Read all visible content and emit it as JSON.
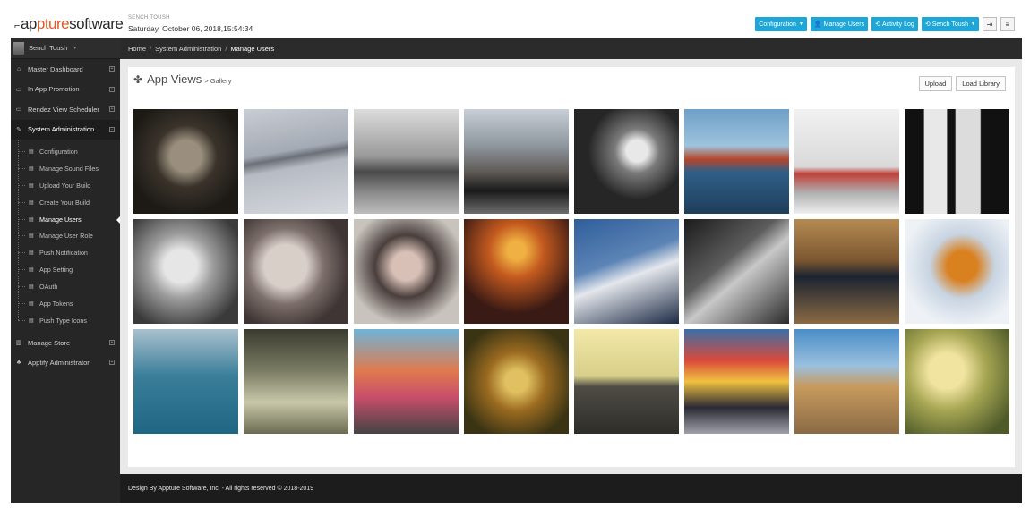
{
  "header": {
    "logo_prefix": "ap",
    "logo_accent": "pture",
    "logo_suffix": "software",
    "app_name": "SENCH TOUSH",
    "datetime": "Saturday, October 06, 2018,15:54:34",
    "buttons": [
      {
        "label": "Configuration",
        "icon": "",
        "caret": true
      },
      {
        "label": "Manage Users",
        "icon": "user-icon",
        "caret": false
      },
      {
        "label": "Activity Log",
        "icon": "history-icon",
        "caret": false
      },
      {
        "label": "Sench Toush",
        "icon": "history-icon",
        "caret": true
      }
    ],
    "accent_color": "#1fa6d9"
  },
  "sidebar": {
    "user": "Sench Toush",
    "menu": [
      {
        "label": "Master Dashboard",
        "icon": "home-icon"
      },
      {
        "label": "In App Promotion",
        "icon": "monitor-icon"
      },
      {
        "label": "Rendez View Scheduler",
        "icon": "monitor-icon"
      },
      {
        "label": "System Administration",
        "icon": "edit-icon",
        "active": true
      }
    ],
    "submenu": [
      "Configuration",
      "Manage Sound Files",
      "Upload Your Build",
      "Create Your Build",
      "Manage Users",
      "Manage User Role",
      "Push Notification",
      "App Setting",
      "OAuth",
      "App Tokens",
      "Push Type Icons"
    ],
    "active_submenu": "Manage Users",
    "menu_bottom": [
      {
        "label": "Manage Store",
        "icon": "store-icon"
      },
      {
        "label": "Apptify Administrator",
        "icon": "sitemap-icon"
      }
    ]
  },
  "breadcrumb": [
    "Home",
    "System Administration",
    "Manage Users"
  ],
  "content": {
    "title": "App Views",
    "subtitle": "> Gallery",
    "upload_label": "Upload",
    "load_library_label": "Load Library"
  },
  "gallery": [
    "vintage-camera",
    "foggy-bridge",
    "railway-girl",
    "range-rover",
    "desk-lamp",
    "golden-gate-bridge",
    "dancer",
    "window-silhouette",
    "smoking-woman",
    "clock-face",
    "woman-with-hat",
    "festival-lights",
    "astronaut",
    "guitar",
    "flip-clock-1249",
    "tiger-snow",
    "frozen-trees",
    "skateboarder",
    "girls-with-stroller",
    "dragonfly",
    "empty-road",
    "times-square",
    "colosseum",
    "cardboard-robot-bicycle"
  ],
  "footer": "Design By Appture Software, Inc. - All rights reserved © 2018-2019"
}
